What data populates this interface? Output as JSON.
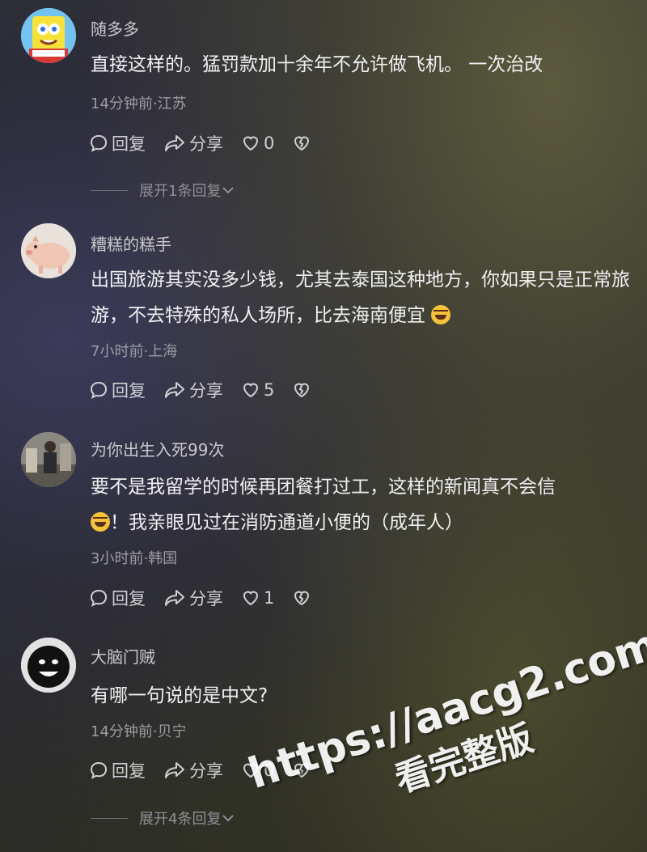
{
  "comments": [
    {
      "username": "随多多",
      "text": "直接这样的。猛罚款加十余年不允许做飞机。 一次治改",
      "emoji": false,
      "meta": "14分钟前·江苏",
      "reply_label": "回复",
      "share_label": "分享",
      "likes": "0",
      "expand": "展开1条回复",
      "avatar": "spongebob-avatar"
    },
    {
      "username": "糟糕的糕手",
      "text": "出国旅游其实没多少钱，尤其去泰国这种地方，你如果只是正常旅游，不去特殊的私人场所，比去海南便宜",
      "emoji": true,
      "meta": "7小时前·上海",
      "reply_label": "回复",
      "share_label": "分享",
      "likes": "5",
      "avatar": "pig-avatar"
    },
    {
      "username": "为你出生入死99次",
      "text_line1": "要不是我留学的时候再团餐打过工，这样的新闻真不会信",
      "text_line2": "！我亲眼见过在消防通道小便的（成年人）",
      "emoji": true,
      "meta": "3小时前·韩国",
      "reply_label": "回复",
      "share_label": "分享",
      "likes": "1",
      "avatar": "photo-avatar"
    },
    {
      "username": "大脑门贼",
      "text": "有哪一句说的是中文?",
      "emoji": false,
      "meta": "14分钟前·贝宁",
      "reply_label": "回复",
      "share_label": "分享",
      "likes": "0",
      "expand": "展开4条回复",
      "more": "···",
      "avatar": "dark-face-avatar"
    }
  ],
  "watermark": {
    "line1": "https://aacg2.com",
    "line2": "看完整版"
  }
}
